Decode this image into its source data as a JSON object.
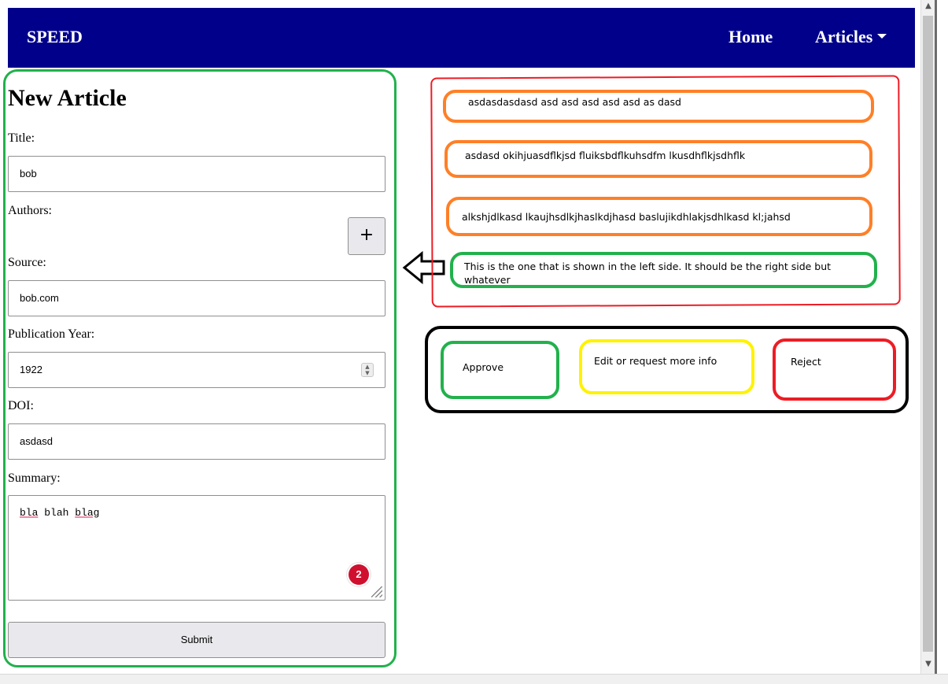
{
  "navbar": {
    "brand": "SPEED",
    "links": {
      "home": "Home",
      "articles": "Articles"
    }
  },
  "form": {
    "heading": "New Article",
    "title_label": "Title:",
    "title_value": "bob",
    "authors_label": "Authors:",
    "add_author_symbol": "+",
    "source_label": "Source:",
    "source_value": "bob.com",
    "year_label": "Publication Year:",
    "year_value": "1922",
    "doi_label": "DOI:",
    "doi_value": "asdasd",
    "summary_label": "Summary:",
    "summary_words": [
      "bla",
      "blah",
      "blag"
    ],
    "spelling_badge_count": "2",
    "submit_label": "Submit"
  },
  "articles_list": [
    "asdasdasdasd asd asd asd asd asd as dasd",
    "asdasd okihjuasdflkjsd fluiksbdflkuhsdfm lkusdhflkjsdhflk",
    "alkshjdlkasd lkaujhsdlkjhaslkdjhasd baslujikdhlakjsdhlkasd kl;jahsd",
    "This is the one that is shown in the left side. It should be the right side but whatever"
  ],
  "actions": {
    "approve": "Approve",
    "edit": "Edit or request more info",
    "reject": "Reject"
  },
  "icons": {
    "caret": "chevron-down-icon",
    "arrow": "left-arrow-icon",
    "plus": "plus-icon"
  },
  "colors": {
    "navbar_bg": "#00008b",
    "green": "#22b14c",
    "orange": "#ff7f27",
    "red": "#ed1c24",
    "yellow": "#fff200",
    "badge": "#d0102f"
  }
}
